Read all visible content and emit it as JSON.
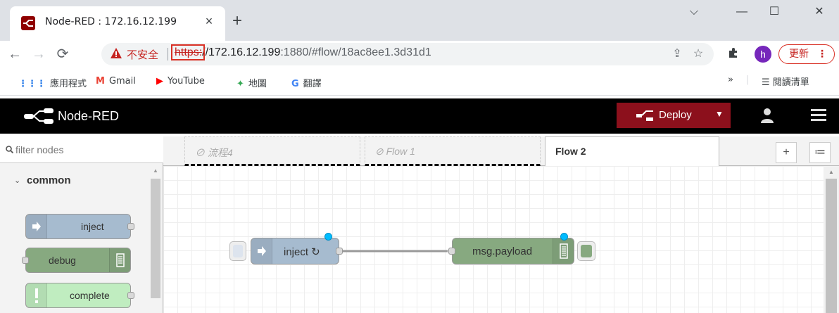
{
  "browser": {
    "tab_title": "Node-RED : 172.16.12.199",
    "tab_close": "×",
    "new_tab": "+",
    "window": {
      "chevron": "⌵",
      "minimize": "—",
      "maximize": "☐",
      "close": "✕"
    },
    "security_label": "不安全",
    "url_protocol": "https:",
    "url_host": "//172.16.12.199",
    "url_path": ":1880/#flow/18ac8ee1.3d31d1",
    "profile_initial": "h",
    "update_label": "更新",
    "update_menu": "⋮",
    "bookmarks": [
      {
        "icon": "apps-grid-icon",
        "label": "應用程式"
      },
      {
        "icon": "gmail-icon",
        "label": "Gmail"
      },
      {
        "icon": "youtube-icon",
        "label": "YouTube"
      },
      {
        "icon": "maps-icon",
        "label": "地圖"
      },
      {
        "icon": "translate-icon",
        "label": "翻譯"
      }
    ],
    "bookmarks_overflow": "»",
    "reading_list": "閱讀清單"
  },
  "nodered": {
    "title": "Node-RED",
    "deploy_label": "Deploy",
    "palette": {
      "filter_placeholder": "filter nodes",
      "category": "common",
      "nodes": [
        {
          "label": "inject",
          "color": "#a6bbcf"
        },
        {
          "label": "debug",
          "color": "#87a980"
        },
        {
          "label": "complete",
          "color": "#c0edc0"
        }
      ]
    },
    "tabs": [
      {
        "label": "流程4",
        "disabled": true
      },
      {
        "label": "Flow 1",
        "disabled": true
      },
      {
        "label": "Flow 2",
        "disabled": false,
        "active": true
      }
    ],
    "add_tab": "+",
    "tab_list": "≔",
    "flow_nodes": [
      {
        "label": "inject ↻",
        "type": "inject",
        "color": "#a6bbcf",
        "changed": true
      },
      {
        "label": "msg.payload",
        "type": "debug",
        "color": "#87a980",
        "changed": true
      }
    ]
  },
  "colors": {
    "header_bg": "#000000",
    "deploy_bg": "#8c101c",
    "inject": "#a6bbcf",
    "debug": "#87a980",
    "complete": "#c0edc0",
    "changed_dot": "#00bcff"
  }
}
